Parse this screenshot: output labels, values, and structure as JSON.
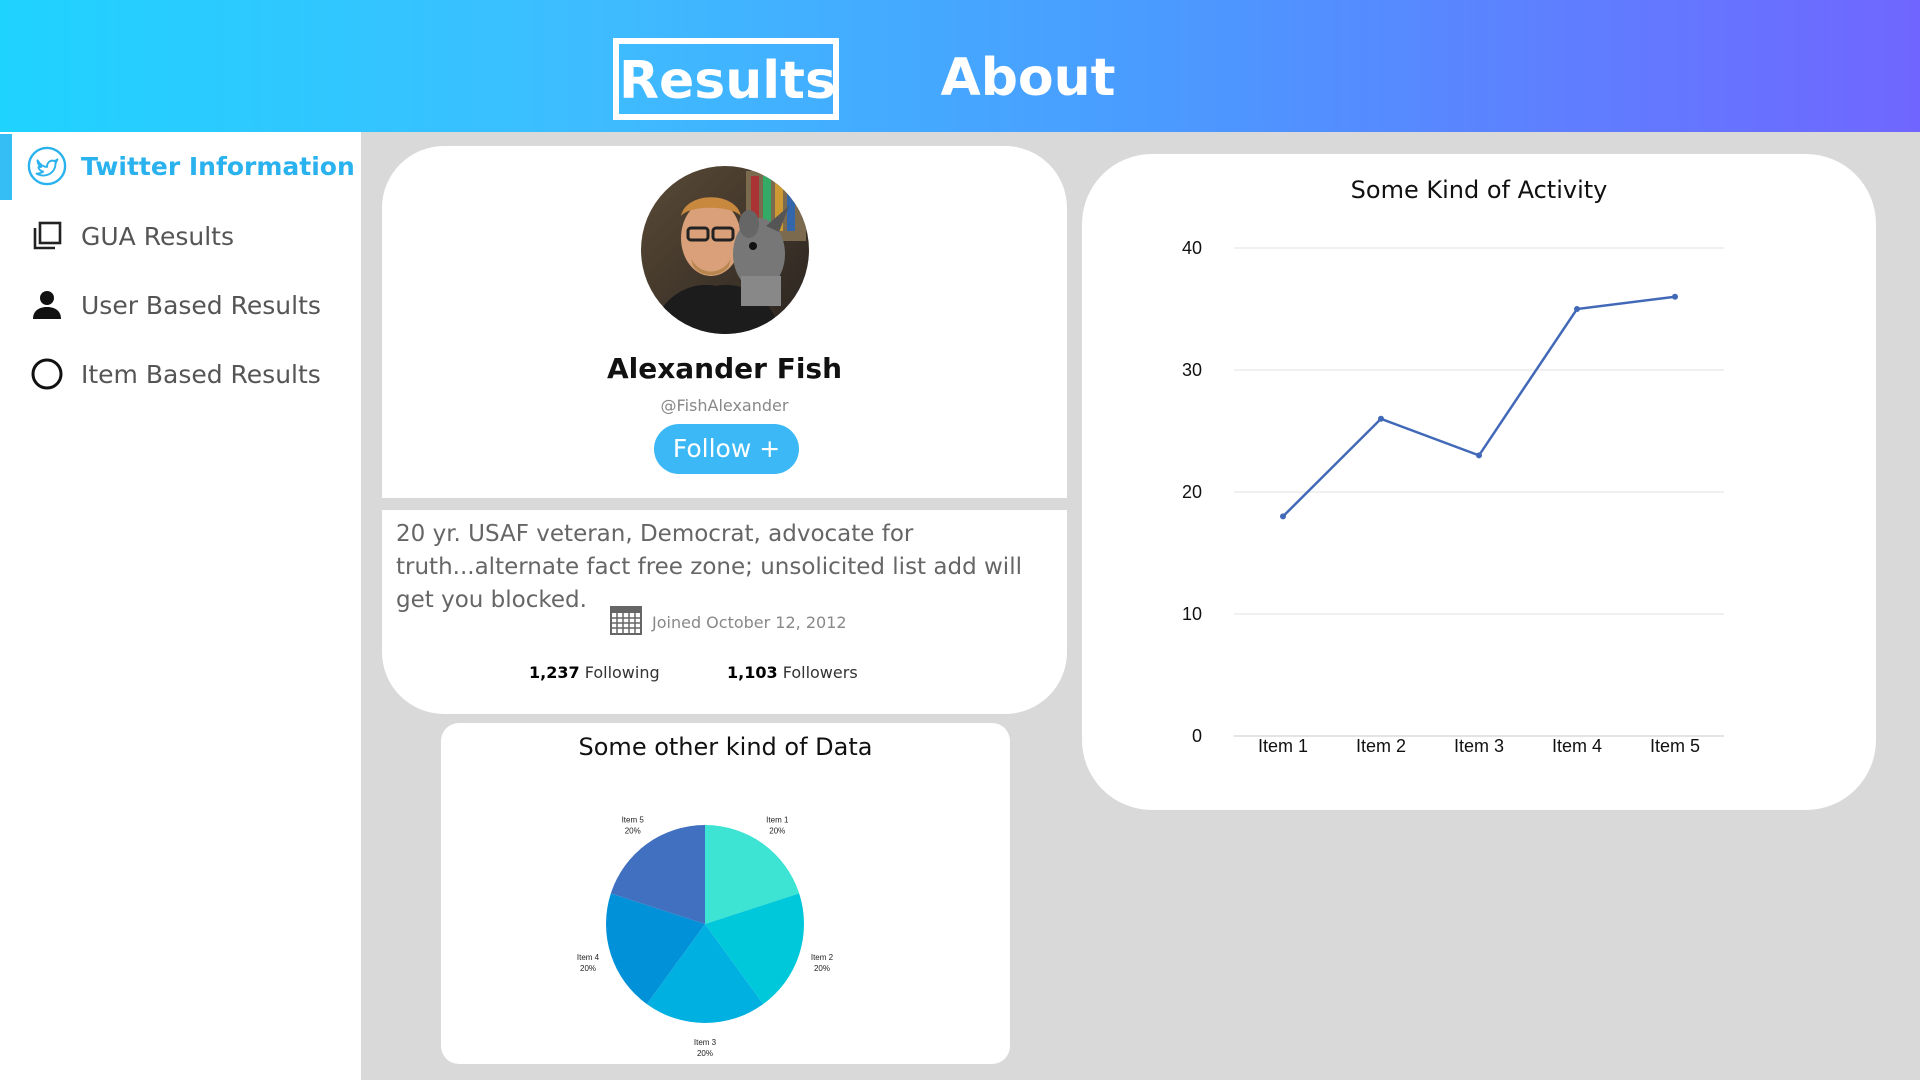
{
  "nav": {
    "tabs": [
      {
        "label": "Results",
        "active": true
      },
      {
        "label": "About",
        "active": false
      }
    ]
  },
  "sidebar": {
    "items": [
      {
        "label": "Twitter Information",
        "icon": "twitter-bird-icon",
        "active": true
      },
      {
        "label": "GUA Results",
        "icon": "copy-stack-icon",
        "active": false
      },
      {
        "label": "User Based Results",
        "icon": "person-icon",
        "active": false
      },
      {
        "label": "Item Based Results",
        "icon": "circle-outline-icon",
        "active": false
      }
    ]
  },
  "profile": {
    "name": "Alexander Fish",
    "handle": "@FishAlexander",
    "follow_label": "Follow +",
    "bio": "20 yr. USAF veteran, Democrat, advocate for truth...alternate fact free zone;  unsolicited list add will get you blocked.",
    "joined": "Joined October 12, 2012",
    "following_count": "1,237",
    "following_label": "Following",
    "followers_count": "1,103",
    "followers_label": "Followers"
  },
  "colors": {
    "accent": "#35bdf5",
    "line_series": "#4169b8",
    "pie": [
      "#3de3d3",
      "#00c8db",
      "#00b0e0",
      "#0091d8",
      "#4170c0"
    ]
  },
  "chart_data": [
    {
      "type": "line",
      "title": "Some Kind of Activity",
      "categories": [
        "Item 1",
        "Item 2",
        "Item 3",
        "Item 4",
        "Item 5"
      ],
      "series": [
        {
          "values": [
            18,
            26,
            23,
            35,
            36
          ]
        }
      ],
      "ylim": [
        0,
        40
      ],
      "yticks": [
        "0",
        "10",
        "20",
        "30",
        "40"
      ],
      "grid": true
    },
    {
      "type": "pie",
      "title": "Some other kind of Data",
      "categories": [
        "Item 1",
        "Item 2",
        "Item 3",
        "Item 4",
        "Item 5"
      ],
      "values": [
        20,
        20,
        20,
        20,
        20
      ],
      "labels": [
        "20%",
        "20%",
        "20%",
        "20%",
        "20%"
      ]
    }
  ]
}
